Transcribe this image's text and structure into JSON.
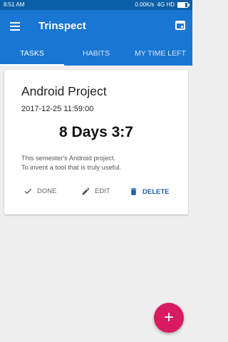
{
  "statusbar": {
    "time": "8:51 AM",
    "net_speed": "0.00K/s",
    "network": "4G HD"
  },
  "appbar": {
    "title": "Trinspect",
    "menu_icon": "menu-icon",
    "calendar_icon": "calendar-icon"
  },
  "tabs": [
    {
      "label": "TASKS",
      "active": true
    },
    {
      "label": "HABITS",
      "active": false
    },
    {
      "label": "MY TIME LEFT",
      "active": false
    }
  ],
  "task": {
    "title": "Android Project",
    "date": "2017-12-25   11:59:00",
    "countdown": "8 Days 3:7",
    "description_line1": "This semester's Android project.",
    "description_line2": "To invent a tool that is truly useful.",
    "actions": {
      "done": "DONE",
      "edit": "EDIT",
      "delete": "DELETE"
    }
  },
  "fab": {
    "label": "+"
  },
  "colors": {
    "primary": "#1976d2",
    "status_bar": "#0a5fa8",
    "accent": "#d81b60",
    "delete": "#1e5fae"
  }
}
